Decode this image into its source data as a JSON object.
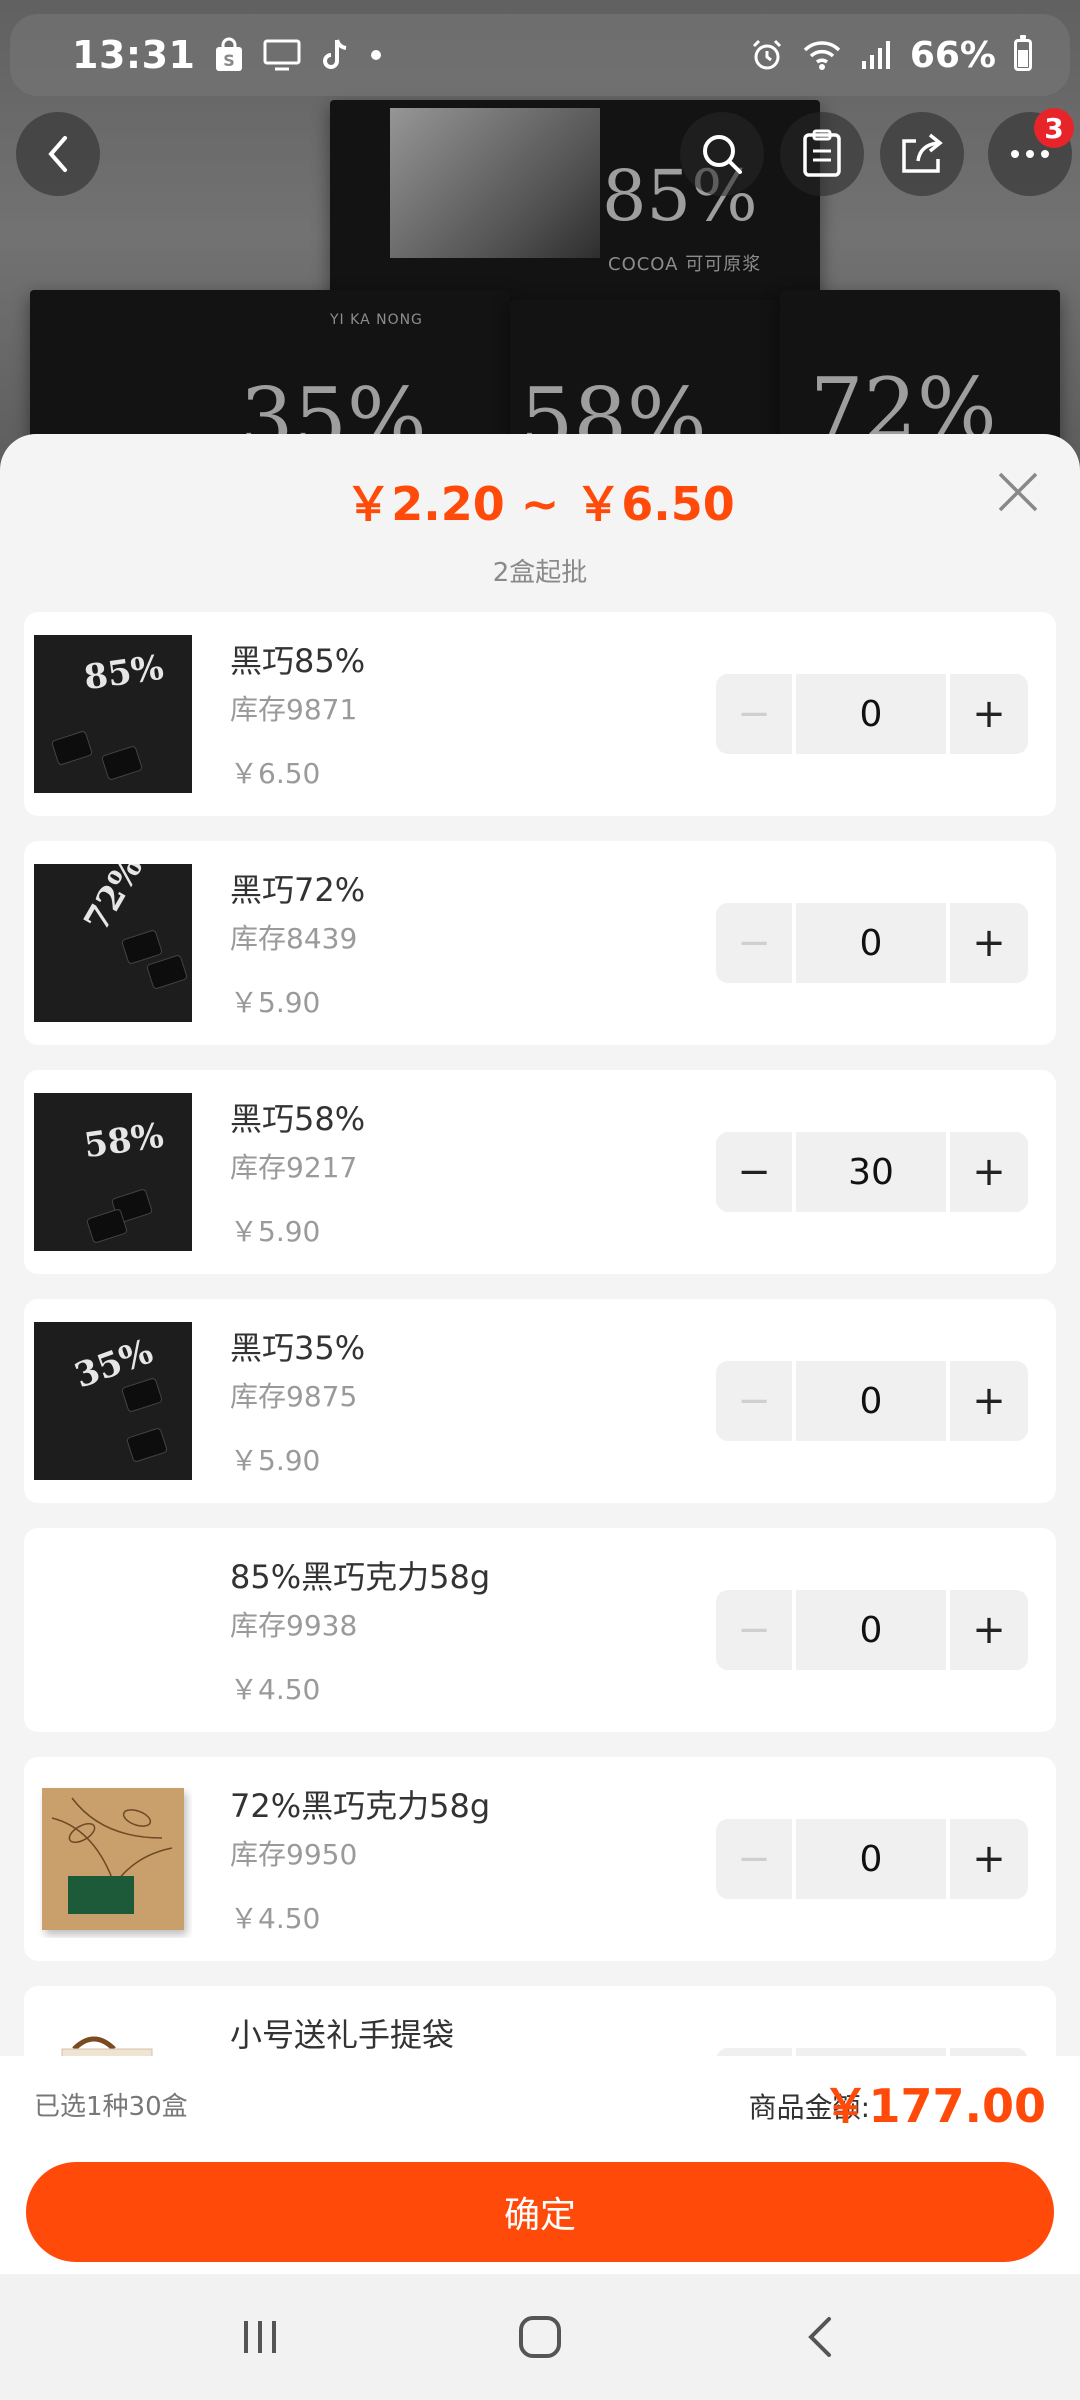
{
  "status_bar": {
    "time": "13:31",
    "battery": "66%",
    "left_icons": [
      "shopping-bag-icon",
      "tv-icon",
      "tiktok-icon",
      "dot-icon"
    ],
    "right_icons": [
      "alarm-icon",
      "wifi-icon",
      "signal-icon",
      "battery-icon"
    ]
  },
  "nav": {
    "cart_badge": "3"
  },
  "hero": {
    "brand": "YI KA NONG",
    "box_labels": [
      "85%",
      "35%",
      "58%",
      "72%"
    ],
    "subtitle": "COCOA 可可原浆"
  },
  "sheet": {
    "price_range": "￥2.20 ~ ￥6.50",
    "min_order": "2盒起批",
    "items": [
      {
        "name": "黑巧85%",
        "stock": "库存9871",
        "price": "￥6.50",
        "qty": "0",
        "thumb_label": "85%"
      },
      {
        "name": "黑巧72%",
        "stock": "库存8439",
        "price": "￥5.90",
        "qty": "0",
        "thumb_label": "72%"
      },
      {
        "name": "黑巧58%",
        "stock": "库存9217",
        "price": "￥5.90",
        "qty": "30",
        "thumb_label": "58%"
      },
      {
        "name": "黑巧35%",
        "stock": "库存9875",
        "price": "￥5.90",
        "qty": "0",
        "thumb_label": "35%"
      },
      {
        "name": "85%黑巧克力58g",
        "stock": "库存9938",
        "price": "￥4.50",
        "qty": "0"
      },
      {
        "name": "72%黑巧克力58g",
        "stock": "库存9950",
        "price": "￥4.50",
        "qty": "0"
      },
      {
        "name": "小号送礼手提袋"
      }
    ],
    "stepper": {
      "minus": "−",
      "plus": "+"
    }
  },
  "summary": {
    "selected": "已选1种30盒",
    "amount_label": "商品金额:",
    "amount": "￥177.00",
    "confirm": "确定"
  },
  "colors": {
    "accent": "#ff4a0a",
    "badge": "#e8242b"
  }
}
